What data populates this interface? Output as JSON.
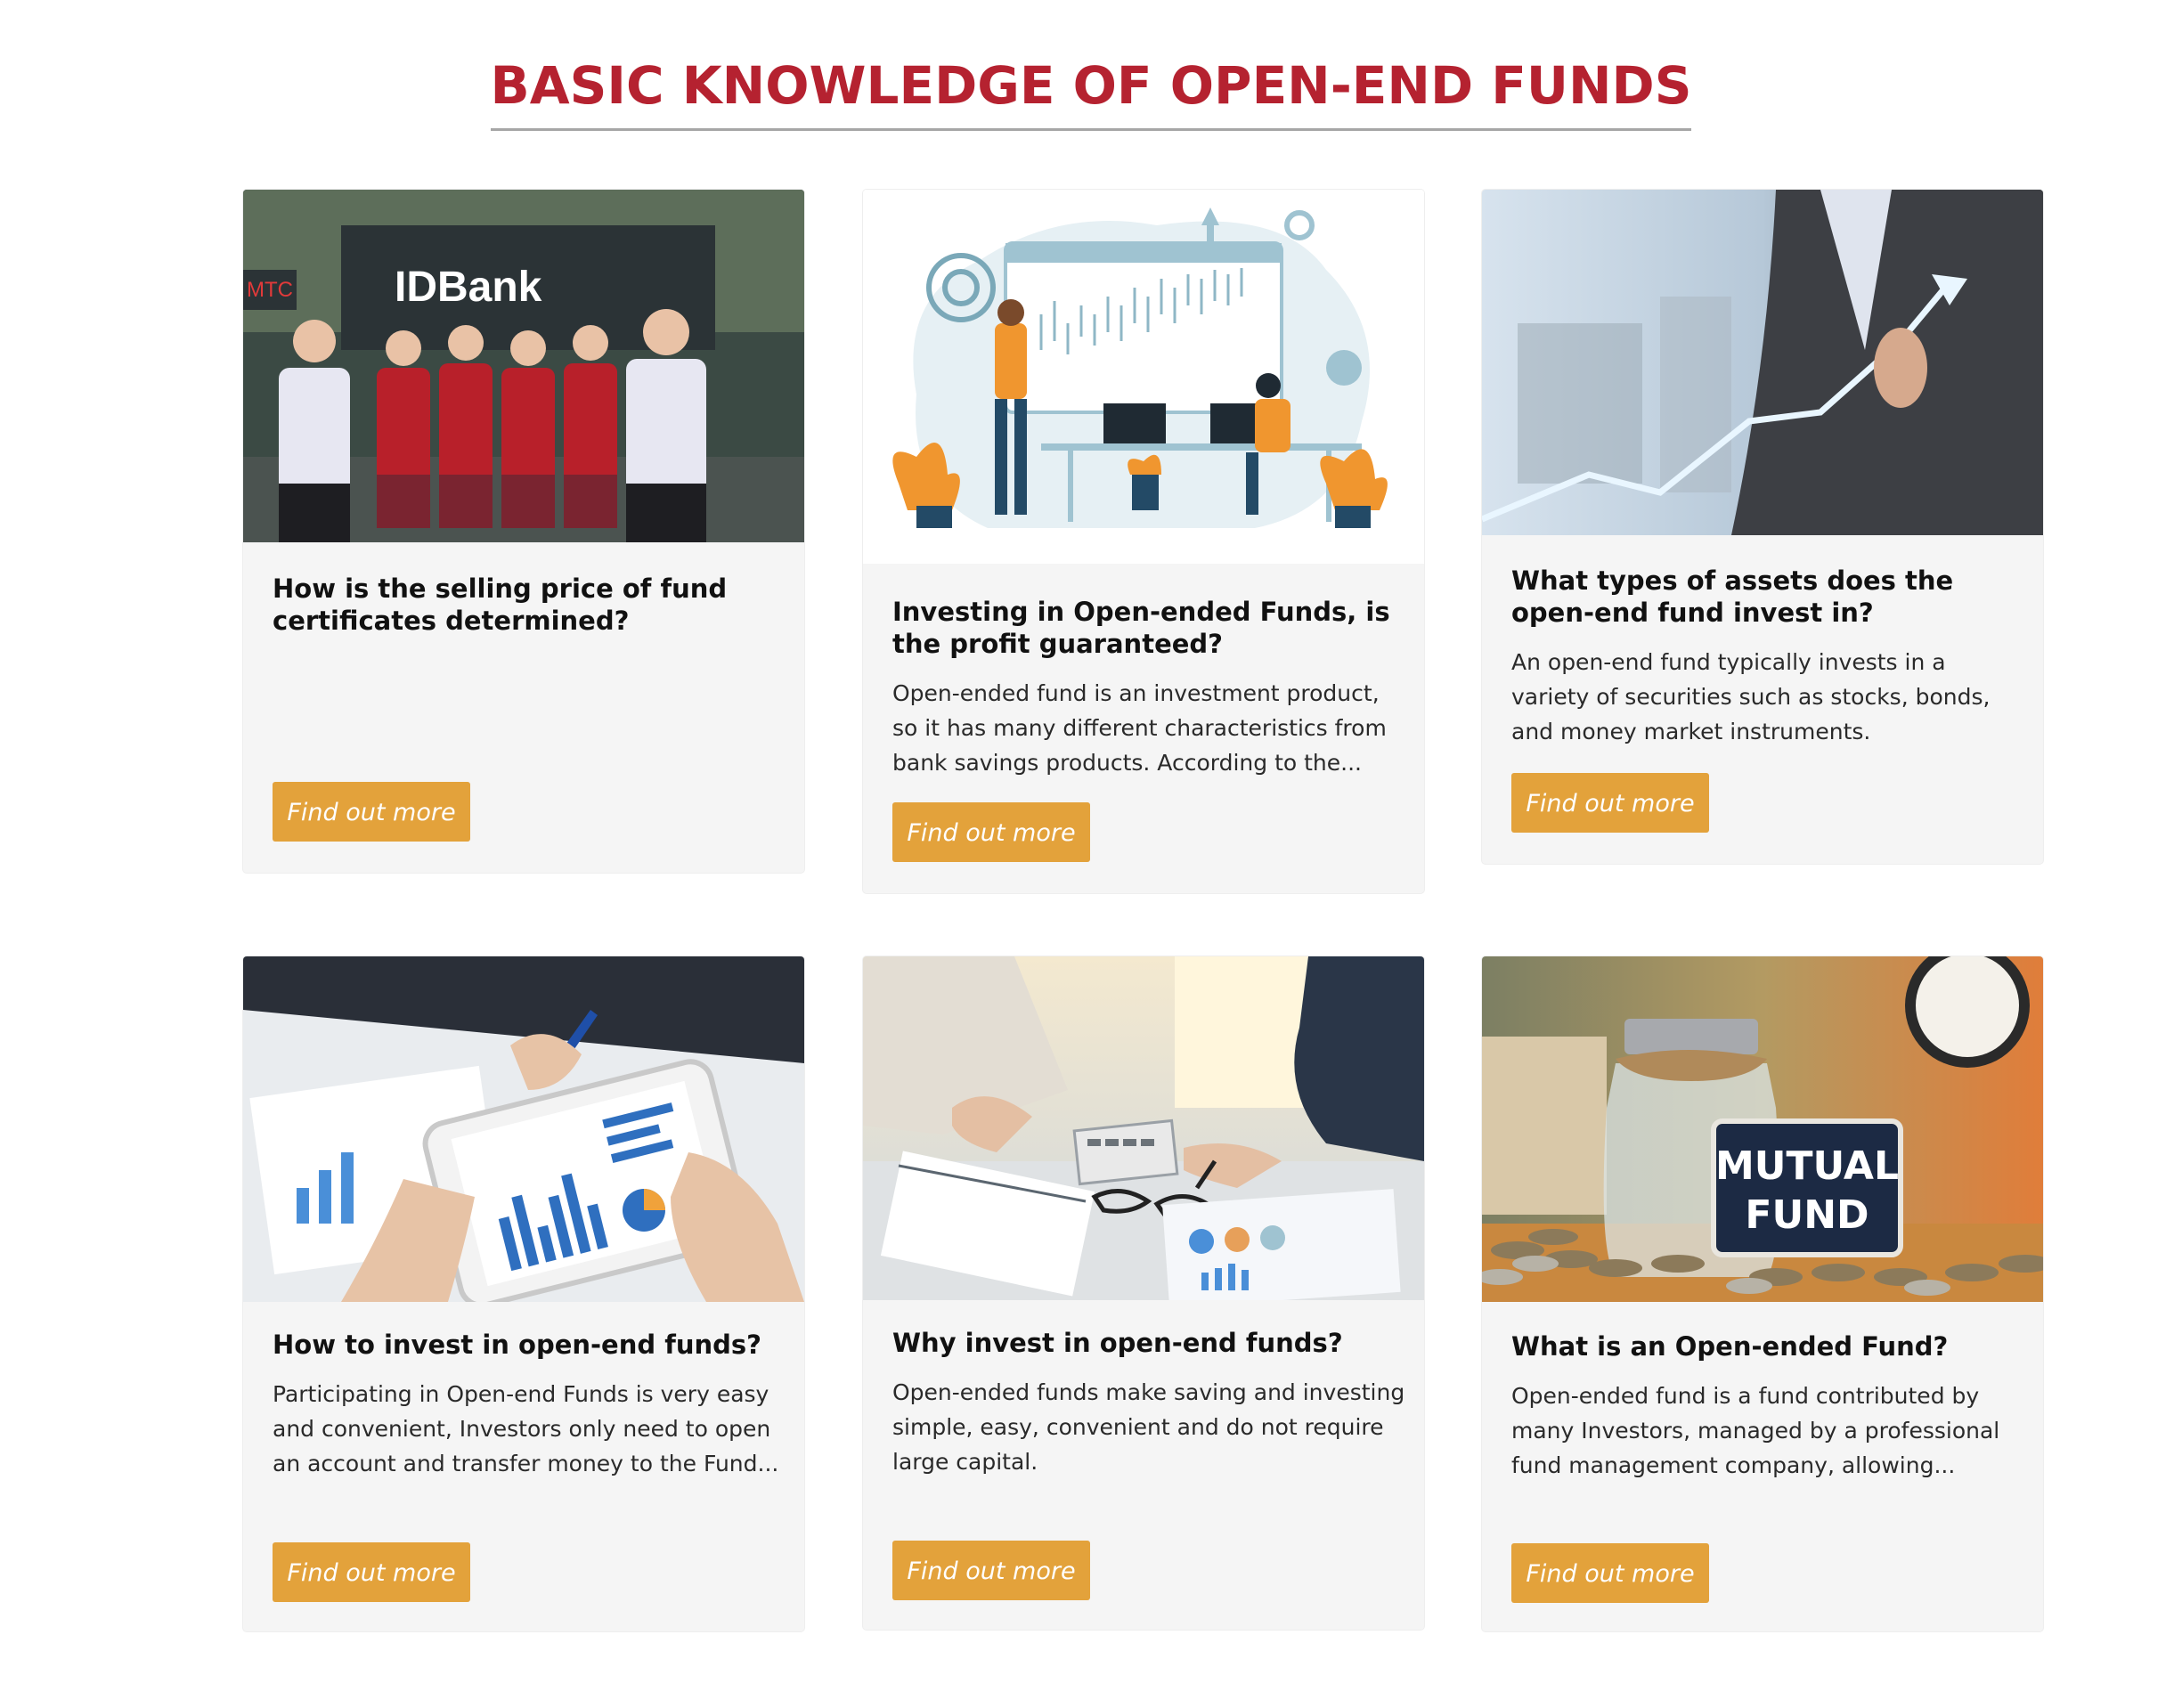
{
  "section": {
    "title": "BASIC KNOWLEDGE OF OPEN-END FUNDS"
  },
  "cards": [
    {
      "title": "How is the selling price of fund certificates determined?",
      "excerpt": "",
      "button": "Find out more",
      "image": "photo of bank staff in red uniforms joining hands in front of bank sign"
    },
    {
      "title": "Investing in Open-ended Funds, is the profit guaranteed?",
      "excerpt": "Open-ended fund is an investment product, so it has many different characteristics from bank savings products. According to the...",
      "button": "Find out more",
      "image": "illustration of people analyzing candlestick chart on screen"
    },
    {
      "title": "What types of assets does the open-end fund invest in?",
      "excerpt": "An open-end fund typically invests in a variety of securities such as stocks, bonds, and money market instruments.",
      "button": "Find out more",
      "image": "businessman pointing at rising arrow graph"
    },
    {
      "title": "How to invest in open-end funds?",
      "excerpt": "Participating in Open-end Funds is very easy and convenient, Investors only need to open an account and transfer money to the Fund...",
      "button": "Find out more",
      "image": "hands holding tablet with charts over documents"
    },
    {
      "title": "Why invest in open-end funds?",
      "excerpt": "Open-ended funds make saving and investing simple, easy, convenient and do not require large capital.",
      "button": "Find out more",
      "image": "desk with calculator, notebook, glasses and reports"
    },
    {
      "title": "What is an Open-ended Fund?",
      "excerpt": "Open-ended fund is a fund contributed by many Investors, managed by a professional fund management company, allowing...",
      "button": "Find out more",
      "image": "glass jar of coins with MUTUAL FUND sign",
      "sign_text": [
        "MUTUAL",
        "FUND"
      ]
    }
  ],
  "colors": {
    "title_red": "#b52230",
    "button_orange": "#e3a23b",
    "card_bg": "#f5f5f5"
  }
}
